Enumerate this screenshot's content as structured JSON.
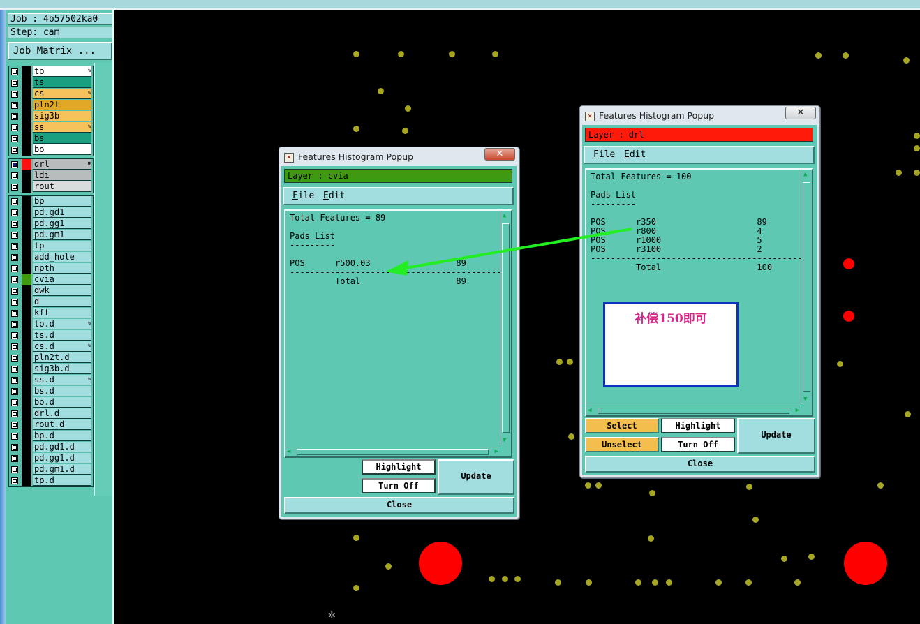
{
  "job_info": {
    "job": "Job : 4b57502ka0",
    "step": "Step: cam",
    "job_matrix_button": "Job Matrix ..."
  },
  "layers_group1": [
    {
      "name": "to",
      "color": "#ffffff",
      "flag": "✎"
    },
    {
      "name": "ts",
      "color": "#1aa080",
      "flag": ""
    },
    {
      "name": "cs",
      "color": "#f6c25c",
      "flag": "✎"
    },
    {
      "name": "pln2t",
      "color": "#e0a826",
      "flag": ""
    },
    {
      "name": "sig3b",
      "color": "#f6c25c",
      "flag": ""
    },
    {
      "name": "ss",
      "color": "#f6c25c",
      "flag": "✎"
    },
    {
      "name": "bs",
      "color": "#1aa080",
      "flag": ""
    },
    {
      "name": "bo",
      "color": "#ffffff",
      "flag": ""
    }
  ],
  "layers_group2": [
    {
      "name": "drl",
      "color": "#b8bcbc",
      "flag": "⊞"
    },
    {
      "name": "ldi",
      "color": "#b8bcbc",
      "flag": ""
    },
    {
      "name": "rout",
      "color": "#d8dcdc",
      "flag": ""
    }
  ],
  "layers_group3": [
    {
      "name": "bp",
      "flag": ""
    },
    {
      "name": "pd.gd1",
      "flag": ""
    },
    {
      "name": "pd.gg1",
      "flag": ""
    },
    {
      "name": "pd.gm1",
      "flag": ""
    },
    {
      "name": "tp",
      "flag": ""
    },
    {
      "name": "add_hole",
      "flag": ""
    },
    {
      "name": "npth",
      "flag": ""
    },
    {
      "name": "cvia",
      "flag": ""
    },
    {
      "name": "dwk",
      "flag": ""
    },
    {
      "name": "d",
      "flag": ""
    },
    {
      "name": "kft",
      "flag": ""
    },
    {
      "name": "to.d",
      "flag": "✎"
    },
    {
      "name": "ts.d",
      "flag": ""
    },
    {
      "name": "cs.d",
      "flag": "✎"
    },
    {
      "name": "pln2t.d",
      "flag": ""
    },
    {
      "name": "sig3b.d",
      "flag": ""
    },
    {
      "name": "ss.d",
      "flag": "✎"
    },
    {
      "name": "bs.d",
      "flag": ""
    },
    {
      "name": "bo.d",
      "flag": ""
    },
    {
      "name": "drl.d",
      "flag": ""
    },
    {
      "name": "rout.d",
      "flag": ""
    },
    {
      "name": "bp.d",
      "flag": ""
    },
    {
      "name": "pd.gd1.d",
      "flag": ""
    },
    {
      "name": "pd.gg1.d",
      "flag": ""
    },
    {
      "name": "pd.gm1.d",
      "flag": ""
    },
    {
      "name": "tp.d",
      "flag": ""
    }
  ],
  "popup_left": {
    "title": "Features Histogram Popup",
    "layer_label": "Layer :  cvia",
    "layer_color": "#3f9a12",
    "menu": {
      "file": "File",
      "edit": "Edit"
    },
    "text": "Total Features = 89\n\nPads List\n---------\n\nPOS      r500.03                 89\n------------------------------------------\n         Total                   89",
    "buttons": {
      "highlight": "Highlight",
      "turn_off": "Turn Off",
      "update": "Update",
      "close": "Close"
    },
    "close_x": "✕"
  },
  "popup_right": {
    "title": "Features Histogram Popup",
    "layer_label": "Layer :  drl",
    "layer_color": "#ff1a0a",
    "menu": {
      "file": "File",
      "edit": "Edit"
    },
    "text": "Total Features = 100\n\nPads List\n---------\n\nPOS      r350                    89\nPOS      r800                    4\nPOS      r1000                   5\nPOS      r3100                   2\n------------------------------------------\n         Total                   100",
    "note": "补偿150即可",
    "buttons": {
      "select": "Select",
      "highlight": "Highlight",
      "unselect": "Unselect",
      "turn_off": "Turn Off",
      "update": "Update",
      "close": "Close"
    },
    "close_x": "✕"
  }
}
